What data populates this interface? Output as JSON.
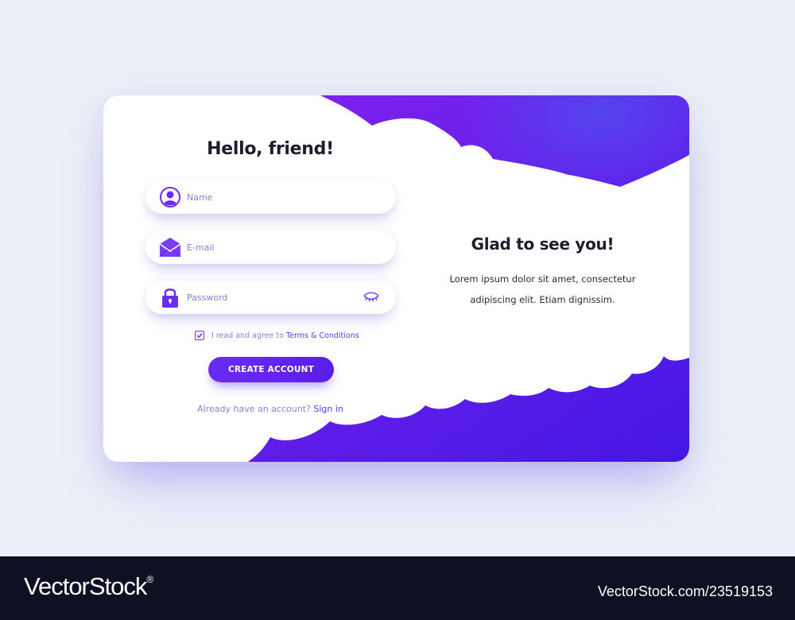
{
  "form": {
    "title": "Hello, friend!",
    "name_placeholder": "Name",
    "email_placeholder": "E-mail",
    "password_placeholder": "Password",
    "agree_text": "I read and agree to ",
    "terms_link": "Terms & Conditions",
    "agree_checked": true,
    "create_button": "CREATE ACCOUNT",
    "already_text": "Already have an account? ",
    "signin_link": "Sign in"
  },
  "welcome": {
    "title": "Glad to see you!",
    "text": "Lorem ipsum dolor sit amet, consectetur adipiscing elit. Etiam dignissim."
  },
  "watermark": {
    "brand": "VectorStock",
    "registered": "®",
    "image_id": "VectorStock.com/23519153"
  },
  "colors": {
    "accent": "#6b2cf5",
    "background": "#eceff7",
    "gradient_start": "#7a1cf0",
    "gradient_end": "#4a18e6"
  }
}
